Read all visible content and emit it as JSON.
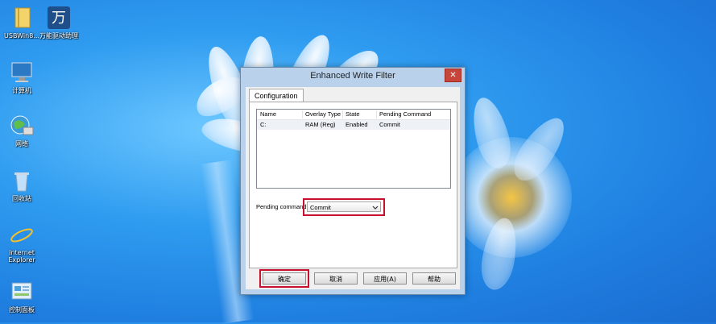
{
  "desktop": {
    "icons": [
      {
        "label": "USBWin8...",
        "icon": "folder-icon"
      },
      {
        "label": "万能驱动助理",
        "icon": "driver-app-icon"
      },
      {
        "label": "计算机",
        "icon": "computer-icon"
      },
      {
        "label": "网络",
        "icon": "network-icon"
      },
      {
        "label": "回收站",
        "icon": "recycle-bin-icon"
      },
      {
        "label": "Internet Explorer",
        "icon": "internet-explorer-icon"
      },
      {
        "label": "控制面板",
        "icon": "control-panel-icon"
      }
    ]
  },
  "dialog": {
    "title": "Enhanced Write Filter",
    "close_glyph": "✕",
    "tab_label": "Configuration",
    "table": {
      "columns": [
        "Name",
        "Overlay Type",
        "State",
        "Pending Command"
      ],
      "rows": [
        [
          "C:",
          "RAM (Reg)",
          "Enabled",
          "Commit"
        ]
      ]
    },
    "pending_label": "Pending command:",
    "pending_value": "Commit",
    "buttons": {
      "ok": "确定",
      "cancel": "取消",
      "apply": "应用(A)",
      "help": "帮助"
    }
  },
  "colors": {
    "highlight": "#c8102e",
    "titlebar": "#b9d1ea",
    "close": "#c7453a"
  }
}
